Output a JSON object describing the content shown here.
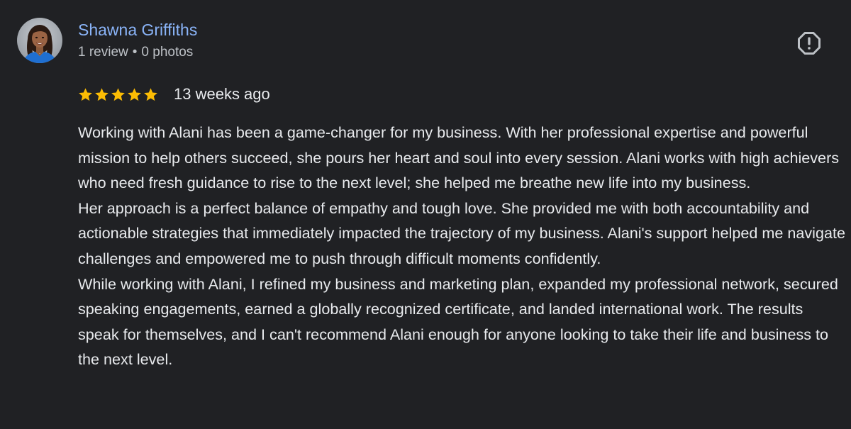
{
  "reviewer": {
    "name": "Shawna Griffiths",
    "review_count": "1 review",
    "separator": "•",
    "photo_count": "0 photos",
    "avatar_icon": "reviewer-avatar-photo"
  },
  "report": {
    "icon": "report-flag-icon"
  },
  "rating": {
    "stars": 5,
    "max_stars": 5,
    "date": "13 weeks ago",
    "star_color": "#fbbc04"
  },
  "review": {
    "paragraphs": [
      "Working with Alani has been a game-changer for my business. With her professional expertise and powerful mission to help others succeed, she pours her heart and soul into every session. Alani works with high achievers who need fresh guidance to rise to the next level; she helped me breathe new life into my business.",
      "Her approach is a perfect balance of empathy and tough love. She provided me with both accountability and actionable strategies that immediately impacted the trajectory of my business. Alani's support helped me navigate challenges and empowered me to push through difficult moments confidently.",
      "While working with Alani, I refined my business and marketing plan, expanded my professional network, secured speaking engagements, earned a globally recognized certificate, and landed international work. The results speak for themselves, and I can't recommend Alani enough for anyone looking to take their life and business to the next level."
    ]
  },
  "colors": {
    "background": "#202124",
    "name_link": "#8ab4f8",
    "secondary_text": "#bdc1c6",
    "primary_text": "#e8eaed"
  }
}
